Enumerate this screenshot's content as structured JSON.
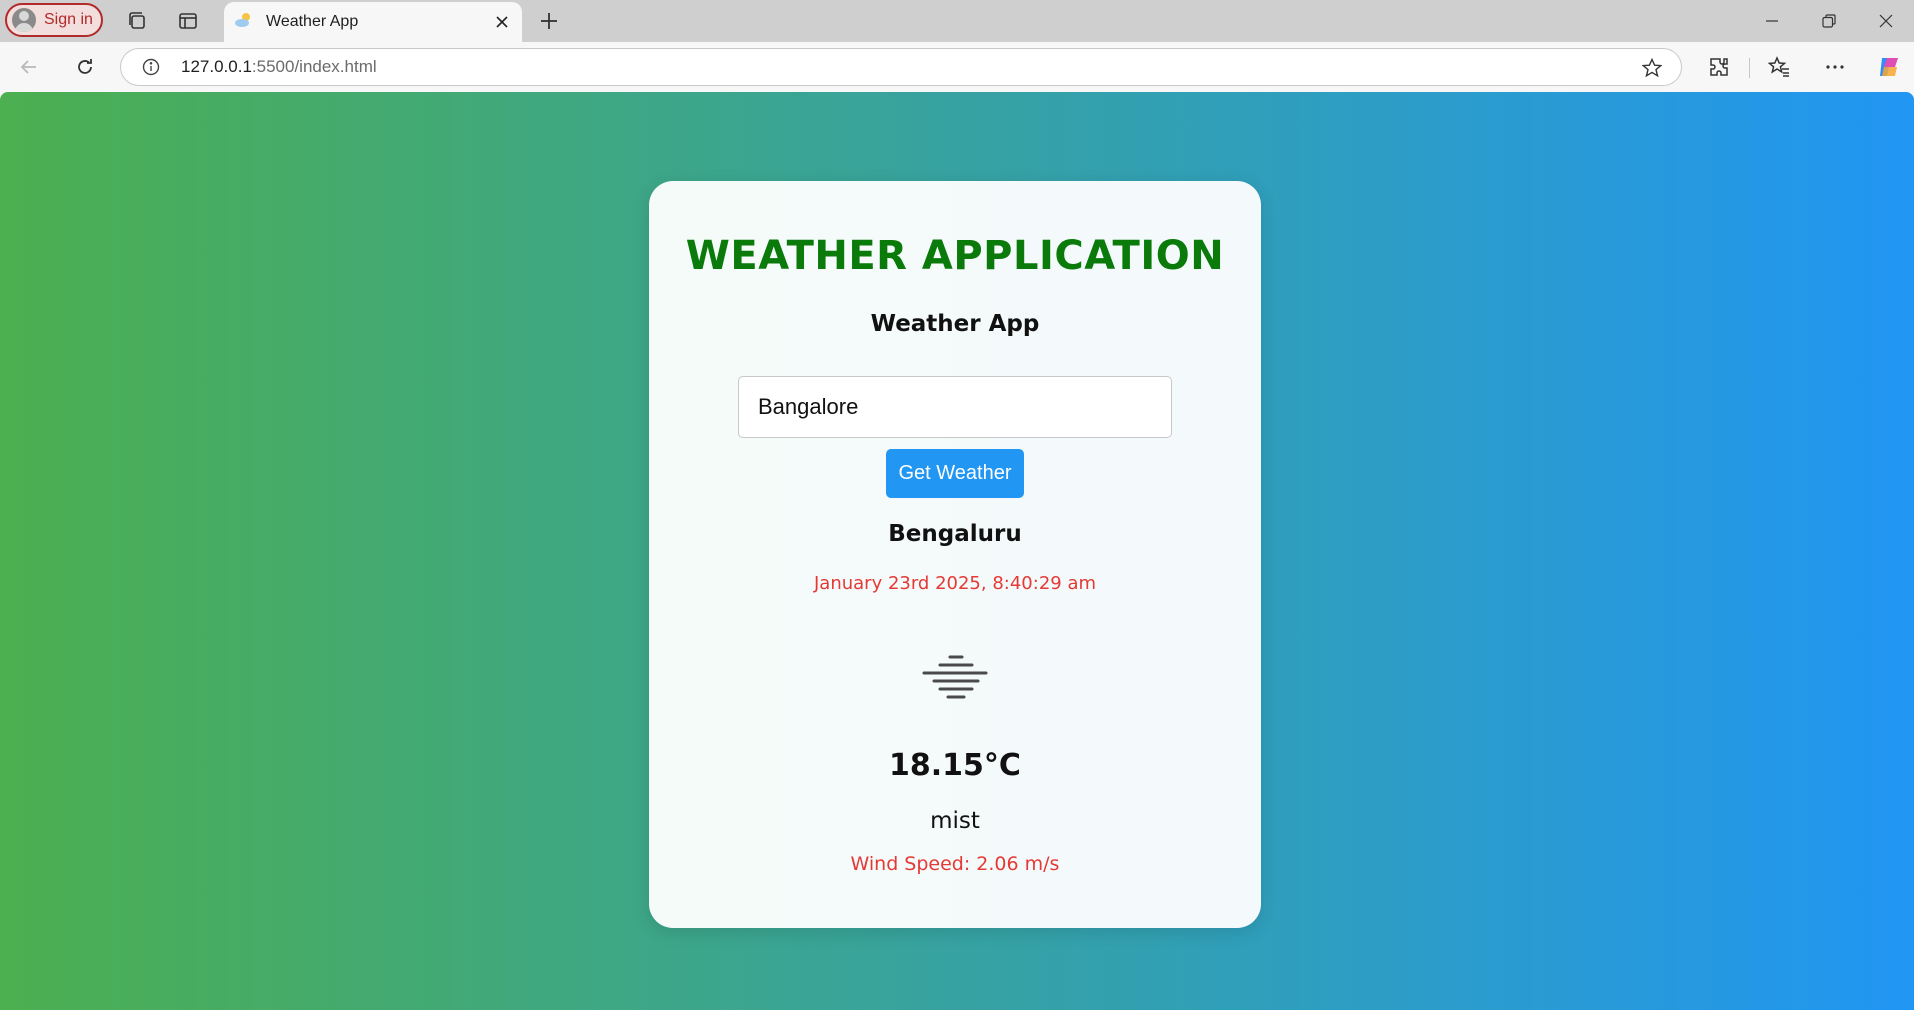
{
  "browser": {
    "signin_label": "Sign in",
    "tab_title": "Weather App",
    "url_host": "127.0.0.1",
    "url_rest": ":5500/index.html"
  },
  "app": {
    "title": "WEATHER APPLICATION",
    "subtitle": "Weather App",
    "search": {
      "value": "Bangalore"
    },
    "get_button_label": "Get Weather",
    "city": "Bengaluru",
    "datetime": "January 23rd 2025, 8:40:29 am",
    "weather_icon": "mist-icon",
    "temperature": "18.15°C",
    "description": "mist",
    "wind": "Wind Speed: 2.06 m/s"
  },
  "colors": {
    "gradient_start": "#4caf50",
    "gradient_end": "#2196f3",
    "title_green": "#0a7a0a",
    "accent_red": "#e53935",
    "button_blue": "#2196f3"
  }
}
